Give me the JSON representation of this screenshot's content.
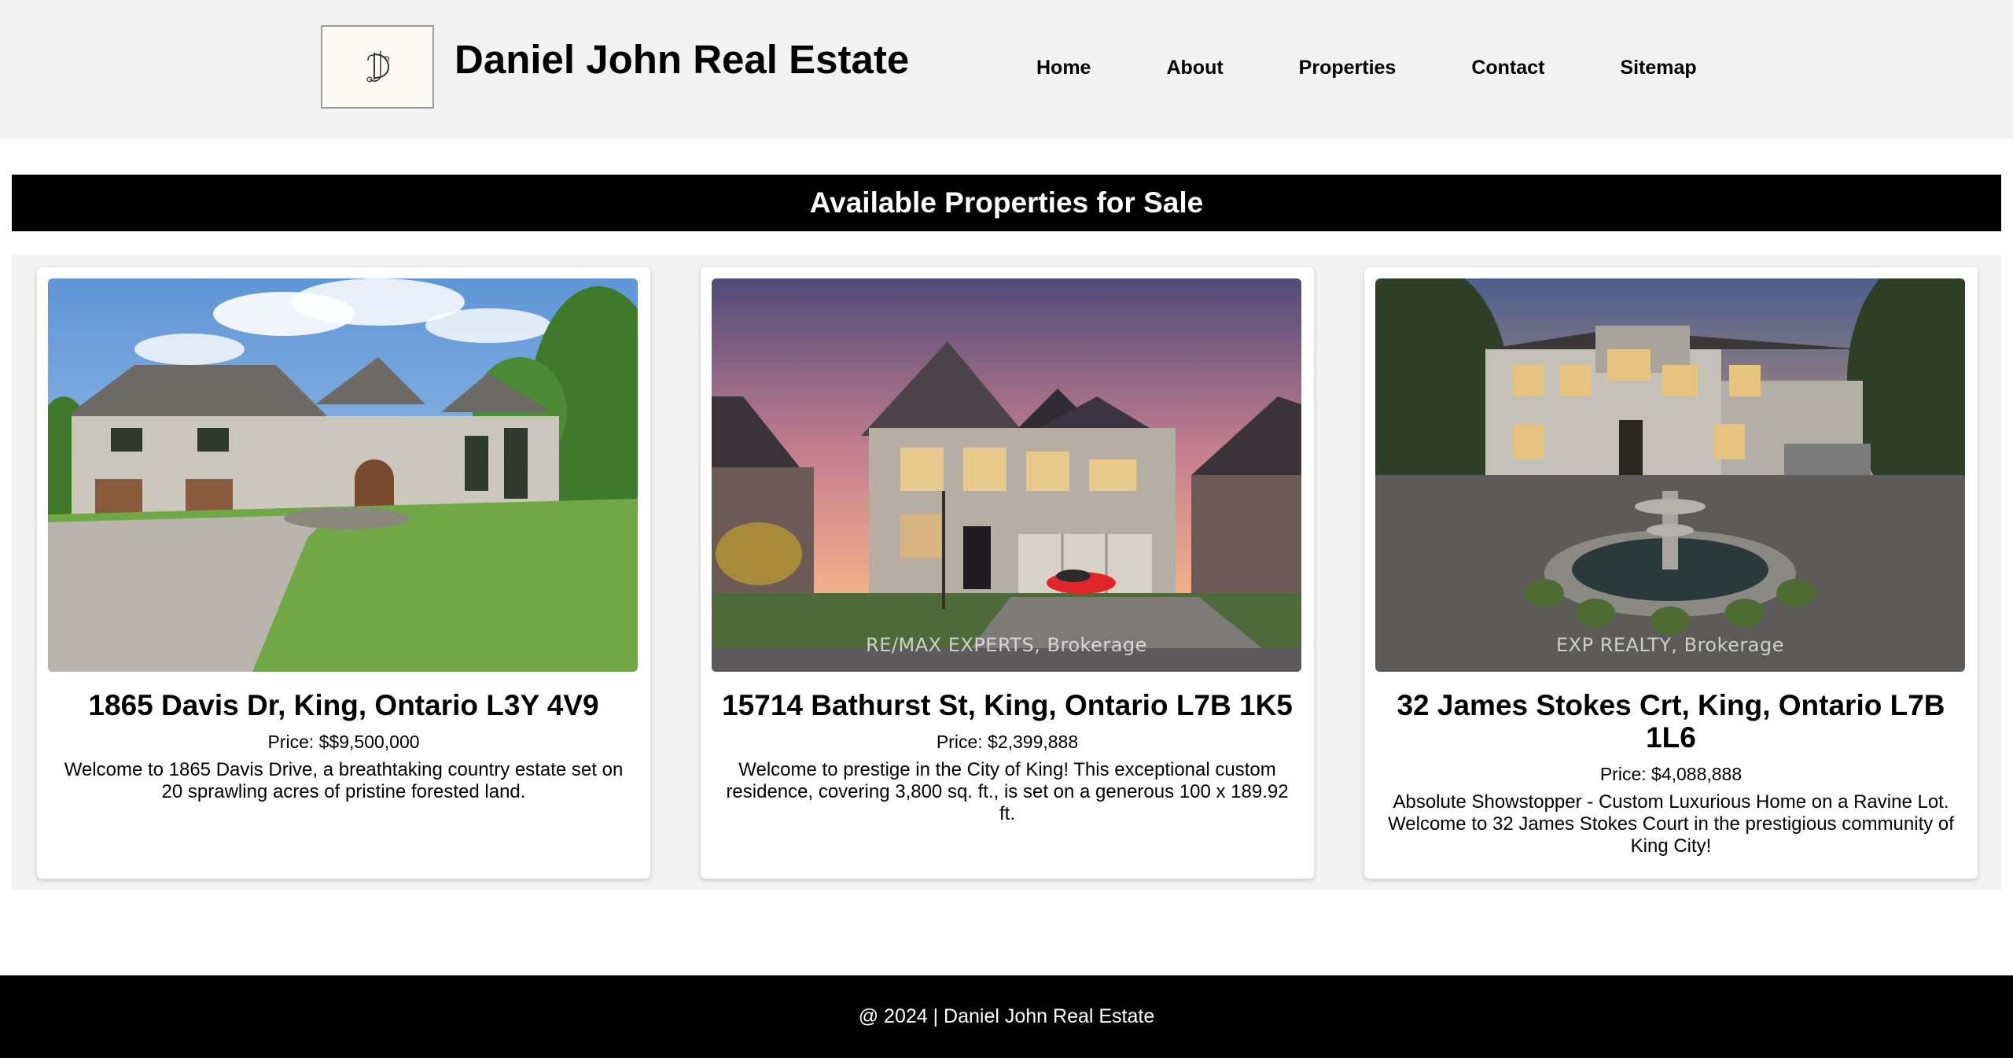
{
  "header": {
    "title": "Daniel John Real Estate",
    "logo_icon": "dj-monogram-logo",
    "nav": [
      {
        "label": "Home"
      },
      {
        "label": "About"
      },
      {
        "label": "Properties"
      },
      {
        "label": "Contact"
      },
      {
        "label": "Sitemap"
      }
    ]
  },
  "banner": {
    "title": "Available Properties for Sale"
  },
  "listings": [
    {
      "address": "1865 Davis Dr, King, Ontario L3Y 4V9",
      "price": "Price: $$9,500,000",
      "description": "Welcome to 1865 Davis Drive, a breathtaking country estate set on 20 sprawling acres of pristine forested land.",
      "watermark": ""
    },
    {
      "address": "15714 Bathurst St, King, Ontario L7B 1K5",
      "price": "Price: $2,399,888",
      "description": "Welcome to prestige in the City of King! This exceptional custom residence, covering 3,800 sq. ft., is set on a generous 100 x 189.92 ft.",
      "watermark": "RE/MAX EXPERTS, Brokerage"
    },
    {
      "address": "32 James Stokes Crt, King, Ontario L7B 1L6",
      "price": "Price: $4,088,888",
      "description": "Absolute Showstopper - Custom Luxurious Home on a Ravine Lot. Welcome to 32 James Stokes Court in the prestigious community of King City!",
      "watermark": "EXP REALTY, Brokerage"
    }
  ],
  "footer": {
    "text": "@ 2024 | Daniel John Real Estate"
  },
  "colors": {
    "header_bg": "#f2f2f2",
    "banner_bg": "#000000",
    "banner_text": "#ffffff",
    "footer_bg": "#000000",
    "card_bg": "#ffffff",
    "listings_bg": "#f2f2f2"
  }
}
